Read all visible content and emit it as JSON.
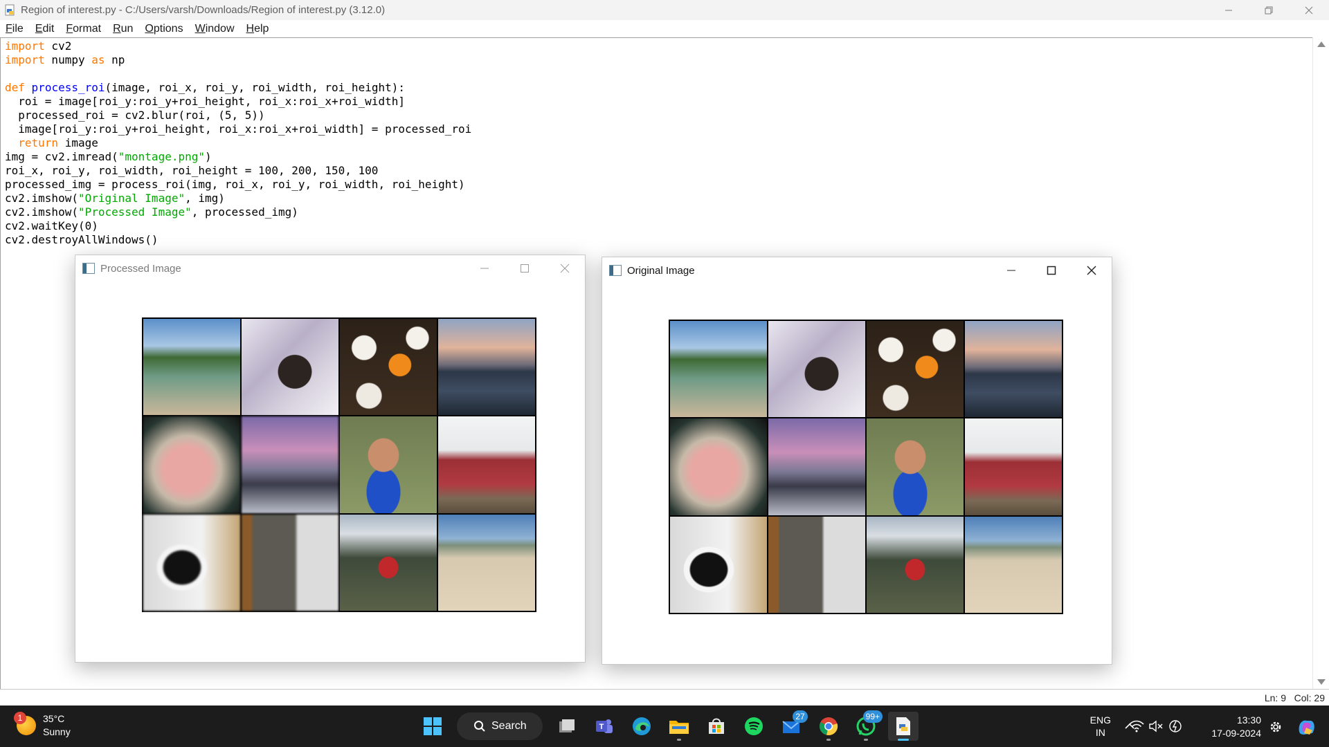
{
  "idle": {
    "window_title": "Region of interest.py - C:/Users/varsh/Downloads/Region of interest.py (3.12.0)",
    "menu": [
      {
        "u": "F",
        "rest": "ile"
      },
      {
        "u": "E",
        "rest": "dit"
      },
      {
        "u": "F",
        "rest": "ormat"
      },
      {
        "u": "R",
        "rest": "un"
      },
      {
        "u": "O",
        "rest": "ptions"
      },
      {
        "u": "W",
        "rest": "indow"
      },
      {
        "u": "H",
        "rest": "elp"
      }
    ],
    "code_lines": [
      [
        {
          "t": "import",
          "c": "kw"
        },
        {
          "t": " cv2",
          "c": ""
        }
      ],
      [
        {
          "t": "import",
          "c": "kw"
        },
        {
          "t": " numpy ",
          "c": ""
        },
        {
          "t": "as",
          "c": "kw"
        },
        {
          "t": " np",
          "c": ""
        }
      ],
      [
        {
          "t": "",
          "c": ""
        }
      ],
      [
        {
          "t": "def",
          "c": "kw"
        },
        {
          "t": " ",
          "c": ""
        },
        {
          "t": "process_roi",
          "c": "fn"
        },
        {
          "t": "(image, roi_x, roi_y, roi_width, roi_height):",
          "c": ""
        }
      ],
      [
        {
          "t": "  roi = image[roi_y:roi_y+roi_height, roi_x:roi_x+roi_width]",
          "c": ""
        }
      ],
      [
        {
          "t": "  processed_roi = cv2.blur(roi, (5, 5))",
          "c": ""
        }
      ],
      [
        {
          "t": "  image[roi_y:roi_y+roi_height, roi_x:roi_x+roi_width] = processed_roi",
          "c": ""
        }
      ],
      [
        {
          "t": "  ",
          "c": ""
        },
        {
          "t": "return",
          "c": "kw"
        },
        {
          "t": " image",
          "c": ""
        }
      ],
      [
        {
          "t": "img = cv2.imread(",
          "c": ""
        },
        {
          "t": "\"montage.png\"",
          "c": "st"
        },
        {
          "t": ")",
          "c": ""
        }
      ],
      [
        {
          "t": "roi_x, roi_y, roi_width, roi_height = 100, 200, 150, 100",
          "c": ""
        }
      ],
      [
        {
          "t": "processed_img = process_roi(img, roi_x, roi_y, roi_width, roi_height)",
          "c": ""
        }
      ],
      [
        {
          "t": "cv2.imshow(",
          "c": ""
        },
        {
          "t": "\"Original Image\"",
          "c": "st"
        },
        {
          "t": ", img)",
          "c": ""
        }
      ],
      [
        {
          "t": "cv2.imshow(",
          "c": ""
        },
        {
          "t": "\"Processed Image\"",
          "c": "st"
        },
        {
          "t": ", processed_img)",
          "c": ""
        }
      ],
      [
        {
          "t": "cv2.waitKey(0)",
          "c": ""
        }
      ],
      [
        {
          "t": "cv2.destroyAllWindows()",
          "c": ""
        }
      ]
    ],
    "status": {
      "ln": "Ln: 9",
      "col": "Col: 29"
    }
  },
  "processed_window": {
    "title": "Processed Image"
  },
  "original_window": {
    "title": "Original Image"
  },
  "montage_tiles": [
    {
      "name": "beach-cove",
      "bg": "linear-gradient(180deg,#5b8fc9 0%,#a9c7e4 28%,#3f6a35 40%,#6f9b86 60%,#c9b79a 100%)"
    },
    {
      "name": "calico-cat",
      "bg": "radial-gradient(circle at 55% 55%,#2b2420 0 22%,transparent 23%),linear-gradient(135deg,#e9e6ef 0%,#b9b0c8 40%,#d8d3df 70%,#f2f0f5 100%)"
    },
    {
      "name": "cupcakes",
      "bg": "radial-gradient(circle at 62% 48%,#f08a1a 0 14%,transparent 15%),radial-gradient(circle at 25% 30%,#f4f1ea 0 12%,transparent 13%),radial-gradient(circle at 80% 20%,#f4f1ea 0 10%,transparent 11%),radial-gradient(circle at 30% 80%,#eeeae2 0 12%,transparent 13%),linear-gradient(180deg,#2c2118,#3e2e20)"
    },
    {
      "name": "lake-sunset",
      "bg": "linear-gradient(180deg,#8fa3c4 0%,#e0b39a 30%,#6c6a78 48%,#2c3748 55%,#3f4d62 75%,#1f2833 100%)"
    },
    {
      "name": "fish-fillet",
      "bg": "radial-gradient(ellipse at 45% 55%,#e8a7a3 0 30%,#c6b9a8 45%,#263530 75%,#111 100%)"
    },
    {
      "name": "pink-sky-snow",
      "bg": "linear-gradient(180deg,#7b6aa8 0%,#c98fb9 35%,#7c7894 55%,#3a3b4a 70%,#b9bcc8 100%)"
    },
    {
      "name": "child-bucket",
      "bg": "radial-gradient(ellipse at 45% 40%,#c98e6c 0 20%,transparent 21%),radial-gradient(ellipse at 45% 78%,#1f50c8 0 22%,transparent 23%),linear-gradient(180deg,#6f7c52,#8b9a66)"
    },
    {
      "name": "red-sofa",
      "bg": "linear-gradient(180deg,#f2f4f4 0%,#e6e9ea 35%,#9c2f36 45%,#b13a41 70%,#7a6a55 85%,#5b4d3d 100%)"
    },
    {
      "name": "penguin-toy",
      "bg": "radial-gradient(ellipse at 40% 55%,#111 0 22%,#f5f5f5 24% 30%,transparent 31%),radial-gradient(circle at 40% 48%,#f0e07a 0 8%,transparent 9%),linear-gradient(90deg,#d9d9d9,#f2f2f2 60%,#c4a574)"
    },
    {
      "name": "hanging-shirt",
      "bg": "linear-gradient(90deg,#8a5a2b 0 10%,#5c5a52 12% 55%,#dcdcdc 58% 100%)"
    },
    {
      "name": "fire-hydrant",
      "bg": "radial-gradient(ellipse at 50% 55%,#c0282c 0 14%,transparent 15%),linear-gradient(180deg,#a8b6c4 0%,#d9dee3 20%,#3e4a3a 45%,#5a6148 100%)"
    },
    {
      "name": "sandy-beach",
      "bg": "linear-gradient(180deg,#4f7fb8 0%,#8fb2d4 25%,#7d8f7a 32%,#d6c9b0 45%,#e2d4ba 100%)"
    }
  ],
  "taskbar": {
    "weather": {
      "temp": "35°C",
      "cond": "Sunny",
      "badge": "1"
    },
    "search_label": "Search",
    "teams_badge": "27",
    "whatsapp_badge": "99+",
    "lang": {
      "line1": "ENG",
      "line2": "IN"
    },
    "clock": {
      "time": "13:30",
      "date": "17-09-2024"
    }
  }
}
